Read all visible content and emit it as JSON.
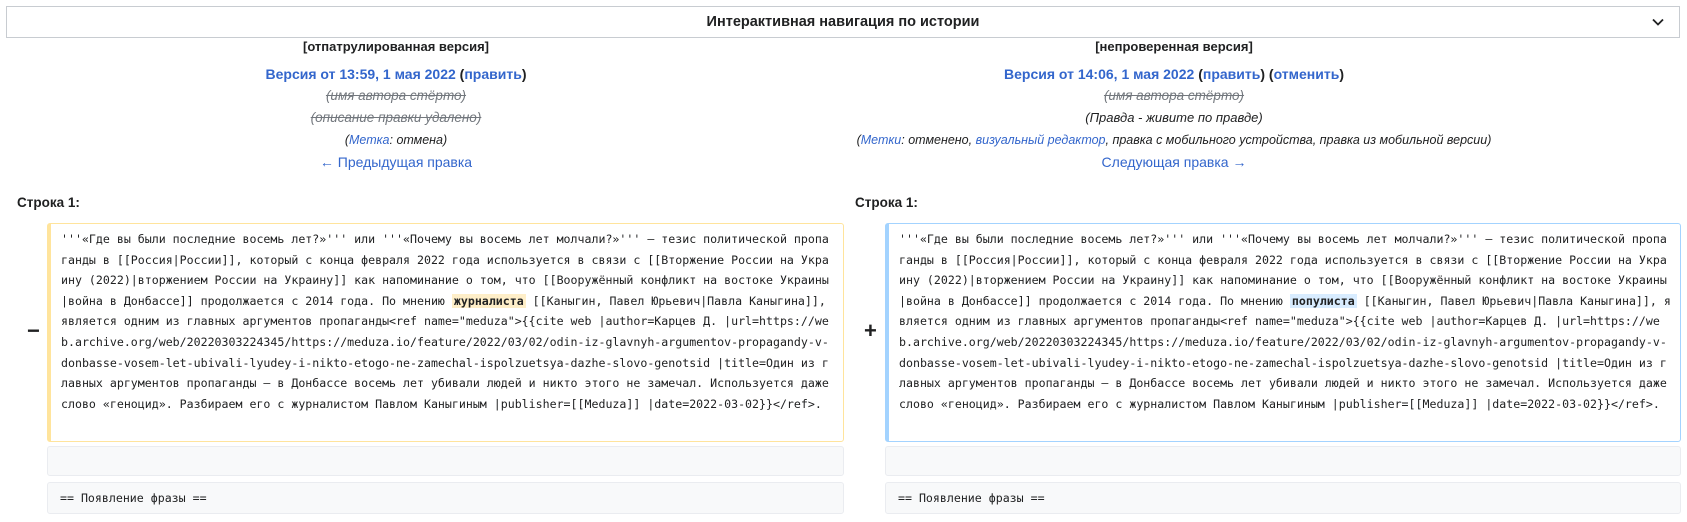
{
  "nav": {
    "title": "Интерактивная навигация по истории",
    "icon": "chevron-down-icon"
  },
  "left": {
    "status": "[отпатрулированная версия]",
    "version_link": "Версия от 13:59, 1 мая 2022",
    "edit_link": "править",
    "author": "(имя автора стёрто)",
    "summary": "(описание правки удалено)",
    "tag_label": "Метка",
    "tag_value": "отмена",
    "nav_link": "← Предыдущая правка",
    "line_label": "Строка 1:",
    "marker": "−",
    "text_before": "'''«Где вы были последние восемь лет?»''' или '''«Почему вы восемь лет молчали?»''' — тезис политической пропаганды в [[Россия|России]], который с конца февраля 2022 года используется в связи с [[Вторжение России на Украину (2022)|вторжением России на Украину]] как напоминание о том, что [[Вооружённый конфликт на востоке Украины|война в Донбассе]] продолжается с 2014 года. По мнению ",
    "changed_word": "журналиста",
    "text_after": " [[Каныгин, Павел Юрьевич|Павла Каныгина]], является одним из главных аргументов пропаганды<ref name=\"meduza\">{{cite web |author=Карцев Д. |url=https://web.archive.org/web/20220303224345/https://meduza.io/feature/2022/03/02/odin-iz-glavnyh-argumentov-propagandy-v-donbasse-vosem-let-ubivali-lyudey-i-nikto-etogo-ne-zamechal-ispolzuetsya-dazhe-slovo-genotsid |title=Один из главных аргументов пропаганды — в Донбассе восемь лет убивали людей и никто этого не замечал. Используется даже слово «геноцид». Разбираем его с журналистом Павлом Каныгиным |publisher=[[Meduza]] |date=2022-03-02}}</ref>.",
    "context_line": "== Появление фразы =="
  },
  "right": {
    "status": "[непроверенная версия]",
    "version_link": "Версия от 14:06, 1 мая 2022",
    "edit_link": "править",
    "undo_link": "отменить",
    "author": "(имя автора стёрто)",
    "summary": "(Правда - живите по правде)",
    "tags_label": "Метки",
    "tag_1": "отменено",
    "tag_2": "визуальный редактор",
    "tag_rest": "правка с мобильного устройства, правка из мобильной версии",
    "nav_link": "Следующая правка →",
    "line_label": "Строка 1:",
    "marker": "+",
    "text_before": "'''«Где вы были последние восемь лет?»''' или '''«Почему вы восемь лет молчали?»''' — тезис политической пропаганды в [[Россия|России]], который с конца февраля 2022 года используется в связи с [[Вторжение России на Украину (2022)|вторжением России на Украину]] как напоминание о том, что [[Вооружённый конфликт на востоке Украины|война в Донбассе]] продолжается с 2014 года. По мнению ",
    "changed_word": "популиста",
    "text_after": " [[Каныгин, Павел Юрьевич|Павла Каныгина]], является одним из главных аргументов пропаганды<ref name=\"meduza\">{{cite web |author=Карцев Д. |url=https://web.archive.org/web/20220303224345/https://meduza.io/feature/2022/03/02/odin-iz-glavnyh-argumentov-propagandy-v-donbasse-vosem-let-ubivali-lyudey-i-nikto-etogo-ne-zamechal-ispolzuetsya-dazhe-slovo-genotsid |title=Один из главных аргументов пропаганды — в Донбассе восемь лет убивали людей и никто этого не замечал. Используется даже слово «геноцид». Разбираем его с журналистом Павлом Каныгиным |publisher=[[Meduza]] |date=2022-03-02}}</ref>.",
    "context_line": "== Появление фразы =="
  },
  "colors": {
    "link": "#3366cc",
    "deleted_border": "#ffe49c",
    "added_border": "#a3d3ff",
    "deleted_highlight": "#feeec8",
    "added_highlight": "#d8ecff"
  }
}
